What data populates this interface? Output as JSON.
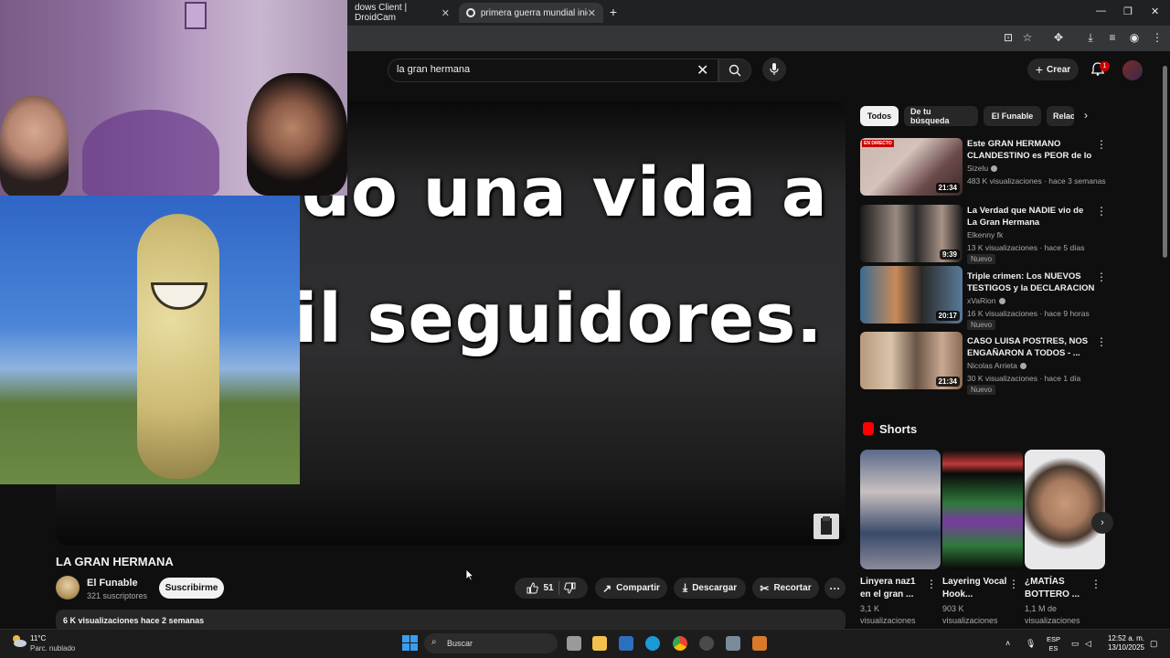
{
  "browser": {
    "tabs": [
      {
        "label": "dows Client | DroidCam",
        "close": "✕"
      },
      {
        "label": "primera guerra mundial inicio ·",
        "close": "✕"
      }
    ],
    "new_tab": "+",
    "window_controls": [
      "—",
      "❐",
      "✕"
    ]
  },
  "youtube": {
    "search": {
      "value": "la gran hermana"
    },
    "create_label": "Crear",
    "notification_count": "1"
  },
  "video": {
    "caption_line_1": "do una vida a",
    "caption_line_2": "il seguidores.",
    "title": "LA GRAN HERMANA",
    "channel": {
      "name": "El Funable",
      "subscribers": "321 suscriptores"
    },
    "subscribe_label": "Suscribirme",
    "likes": "51",
    "share_label": "Compartir",
    "download_label": "Descargar",
    "clip_label": "Recortar",
    "views_line": "6 K visualizaciones  hace 2 semanas"
  },
  "sidebar": {
    "chips": [
      "Todos",
      "De tu búsqueda",
      "El Funable",
      "Relacio"
    ],
    "recommendations": [
      {
        "title": "Este GRAN HERMANO CLANDESTINO es PEOR de lo ...",
        "channel": "Sizelu",
        "verified": true,
        "meta": "483 K visualizaciones · hace 3 semanas",
        "duration": "21:34",
        "badge": "",
        "live_tag": "EN DIRECTO",
        "thumb_colors": [
          "#c9b8ae",
          "#6b4a4a",
          "#d4c2bb"
        ]
      },
      {
        "title": "La Verdad que NADIE vio de La Gran Hermana",
        "channel": "Elkenny fk",
        "verified": false,
        "meta": "13 K visualizaciones · hace 5 días",
        "duration": "9:39",
        "badge": "Nuevo",
        "live_tag": "",
        "thumb_colors": [
          "#2a2a2a",
          "#9b8a80",
          "#1a1a1a"
        ]
      },
      {
        "title": "Triple crimen: Los NUEVOS TESTIGOS y la DECLARACION ...",
        "channel": "xVaRion",
        "verified": true,
        "meta": "16 K visualizaciones · hace 9 horas",
        "duration": "20:17",
        "badge": "Nuevo",
        "live_tag": "",
        "thumb_colors": [
          "#3c6a8e",
          "#c88a5a",
          "#2a2a2a"
        ]
      },
      {
        "title": "CASO LUISA POSTRES, NOS ENGAÑARON A TODOS  - ...",
        "channel": "Nicolas Arrieta",
        "verified": true,
        "meta": "30 K visualizaciones · hace 1 día",
        "duration": "21:34",
        "badge": "Nuevo",
        "live_tag": "",
        "thumb_colors": [
          "#b79a7e",
          "#6a5446",
          "#d9c3aa"
        ]
      }
    ],
    "shorts_heading": "Shorts",
    "shorts": [
      {
        "title": "Linyera naz1 en el gran ...",
        "views": "3,1 K visualizaciones",
        "colors": [
          "#5a6a8a",
          "#c8c0c0",
          "#3a4a6a"
        ]
      },
      {
        "title": "Layering Vocal Hook...",
        "views": "903 K visualizaciones",
        "colors": [
          "#0a0a0a",
          "#2f7a3a",
          "#c03a3a"
        ]
      },
      {
        "title": "¿MATÍAS BOTTERO ...",
        "views": "1,1 M de visualizaciones",
        "colors": [
          "#e8e8ea",
          "#c89a7a",
          "#4a3a30"
        ]
      }
    ]
  },
  "taskbar": {
    "weather_temp": "11°C",
    "weather_desc": "Parc. nublado",
    "search_label": "Buscar",
    "lang_top": "ESP",
    "lang_bottom": "ES",
    "time": "12:52 a. m.",
    "date": "13/10/2025"
  }
}
